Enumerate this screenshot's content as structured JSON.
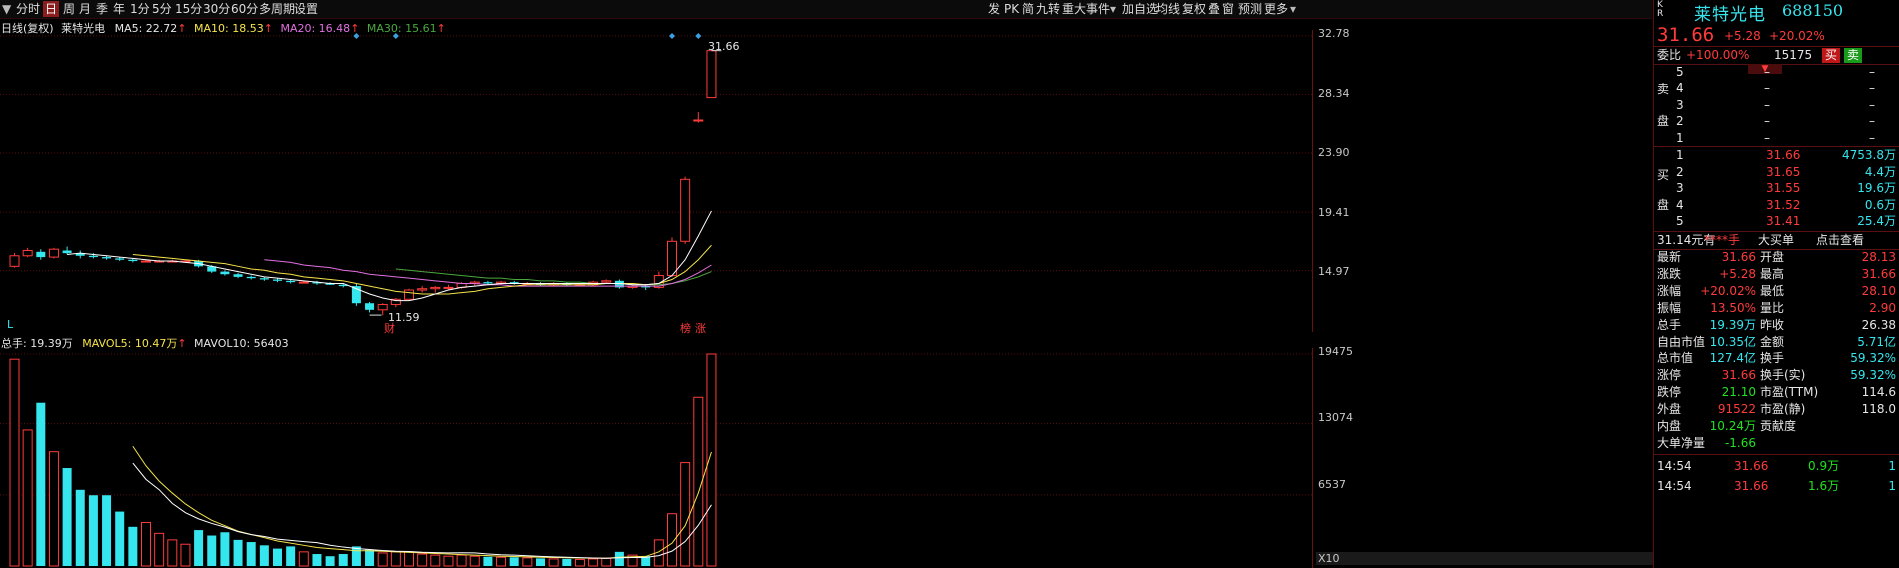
{
  "toolbar": {
    "left": [
      "分时",
      "日",
      "周",
      "月",
      "季",
      "年",
      "1分",
      "5分",
      "15分",
      "30分",
      "60分",
      "多周期",
      "设置"
    ],
    "selected": "日",
    "right": [
      "发",
      "PK",
      "简",
      "九转",
      "重大事件",
      "加自选",
      "均线",
      "复权",
      "叠",
      "窗",
      "预测",
      "更多"
    ]
  },
  "kline": {
    "legend": {
      "title": "日线(复权)",
      "name": "莱特光电",
      "ma5": "MA5: 22.72",
      "ma10": "MA10: 18.53",
      "ma20": "MA20: 16.48",
      "ma30": "MA30: 15.61"
    },
    "y_labels": [
      "32.78",
      "28.34",
      "23.90",
      "19.41",
      "14.97"
    ],
    "high_label": "31.66",
    "low_label": "11.59",
    "markers": {
      "cai": "财",
      "bang": "榜",
      "zhang": "涨",
      "L": "L"
    }
  },
  "volume": {
    "legend": {
      "total": "总手: 19.39万",
      "mavol5": "MAVOL5: 10.47万",
      "mavol10": "MAVOL10: 56403"
    },
    "y_labels": [
      "19475",
      "13074",
      "6537"
    ],
    "unit": "X10"
  },
  "chart_data": {
    "type": "candlestick",
    "ylim": [
      11.0,
      33.0
    ],
    "candles": [
      [
        15.3,
        16.3,
        15.2,
        16.1
      ],
      [
        16.1,
        16.7,
        16.0,
        16.5
      ],
      [
        16.4,
        16.6,
        15.8,
        16.0
      ],
      [
        16.0,
        16.7,
        15.9,
        16.6
      ],
      [
        16.5,
        16.8,
        16.2,
        16.3
      ],
      [
        16.3,
        16.5,
        15.9,
        16.1
      ],
      [
        16.1,
        16.3,
        15.9,
        16.0
      ],
      [
        16.0,
        16.1,
        15.8,
        15.9
      ],
      [
        15.9,
        16.0,
        15.7,
        15.8
      ],
      [
        15.8,
        15.9,
        15.6,
        15.7
      ],
      [
        15.7,
        15.8,
        15.6,
        15.7
      ],
      [
        15.7,
        15.8,
        15.6,
        15.7
      ],
      [
        15.7,
        15.8,
        15.6,
        15.7
      ],
      [
        15.7,
        15.8,
        15.6,
        15.7
      ],
      [
        15.7,
        15.8,
        15.2,
        15.3
      ],
      [
        15.3,
        15.4,
        14.8,
        14.9
      ],
      [
        14.9,
        15.0,
        14.6,
        14.7
      ],
      [
        14.7,
        14.8,
        14.4,
        14.5
      ],
      [
        14.5,
        14.6,
        14.3,
        14.4
      ],
      [
        14.4,
        14.5,
        14.2,
        14.3
      ],
      [
        14.3,
        14.4,
        14.1,
        14.2
      ],
      [
        14.2,
        14.3,
        14.0,
        14.1
      ],
      [
        14.1,
        14.2,
        14.0,
        14.1
      ],
      [
        14.1,
        14.2,
        13.9,
        14.0
      ],
      [
        14.0,
        14.1,
        13.9,
        13.9
      ],
      [
        13.9,
        14.0,
        13.7,
        13.8
      ],
      [
        13.8,
        14.0,
        12.3,
        12.5
      ],
      [
        12.5,
        12.6,
        11.8,
        12.0
      ],
      [
        12.0,
        12.5,
        11.6,
        12.4
      ],
      [
        12.4,
        12.9,
        12.2,
        12.8
      ],
      [
        12.8,
        13.6,
        12.8,
        13.5
      ],
      [
        13.5,
        13.8,
        13.3,
        13.6
      ],
      [
        13.6,
        13.8,
        13.3,
        13.7
      ],
      [
        13.7,
        13.9,
        13.5,
        13.7
      ],
      [
        13.7,
        14.1,
        13.6,
        14.0
      ],
      [
        14.0,
        14.2,
        13.8,
        14.1
      ],
      [
        14.1,
        14.2,
        13.9,
        14.0
      ],
      [
        14.0,
        14.2,
        13.9,
        14.1
      ],
      [
        14.1,
        14.2,
        13.9,
        14.0
      ],
      [
        14.0,
        14.1,
        13.9,
        14.0
      ],
      [
        14.0,
        14.1,
        13.8,
        13.9
      ],
      [
        13.9,
        14.1,
        13.8,
        14.0
      ],
      [
        14.0,
        14.1,
        13.8,
        13.9
      ],
      [
        13.9,
        14.0,
        13.8,
        13.9
      ],
      [
        13.9,
        14.2,
        13.8,
        14.1
      ],
      [
        14.1,
        14.3,
        14.0,
        14.2
      ],
      [
        14.2,
        14.3,
        13.6,
        13.7
      ],
      [
        13.7,
        13.9,
        13.6,
        13.8
      ],
      [
        13.8,
        13.9,
        13.5,
        13.7
      ],
      [
        13.7,
        14.9,
        13.6,
        14.6
      ],
      [
        14.6,
        17.5,
        14.5,
        17.2
      ],
      [
        17.2,
        22.1,
        17.0,
        21.9
      ],
      [
        26.4,
        27.0,
        26.2,
        26.4
      ],
      [
        28.1,
        31.66,
        28.1,
        31.66
      ]
    ],
    "ma5": [
      null,
      null,
      null,
      null,
      16.2,
      16.3,
      16.2,
      16.1,
      16.0,
      15.9,
      15.8,
      15.7,
      15.7,
      15.6,
      15.5,
      15.3,
      15.1,
      14.9,
      14.7,
      14.5,
      14.4,
      14.3,
      14.2,
      14.1,
      14.0,
      14.0,
      13.6,
      13.2,
      12.9,
      12.7,
      12.7,
      12.9,
      13.2,
      13.5,
      13.7,
      13.8,
      13.9,
      14.0,
      14.0,
      14.0,
      14.0,
      14.0,
      14.0,
      14.0,
      14.0,
      14.0,
      14.0,
      13.9,
      13.9,
      14.0,
      14.6,
      15.8,
      17.6,
      19.5
    ],
    "ma10": [
      null,
      null,
      null,
      null,
      null,
      null,
      null,
      null,
      null,
      16.2,
      16.1,
      16.0,
      15.9,
      15.8,
      15.7,
      15.6,
      15.5,
      15.3,
      15.1,
      15.0,
      14.8,
      14.7,
      14.5,
      14.4,
      14.3,
      14.2,
      14.0,
      13.8,
      13.6,
      13.4,
      13.3,
      13.2,
      13.2,
      13.2,
      13.3,
      13.4,
      13.6,
      13.7,
      13.8,
      13.9,
      13.9,
      13.9,
      13.9,
      13.9,
      13.9,
      14.0,
      14.0,
      14.0,
      13.9,
      14.0,
      14.3,
      14.9,
      15.8,
      16.9
    ],
    "ma20": [
      null,
      null,
      null,
      null,
      null,
      null,
      null,
      null,
      null,
      null,
      null,
      null,
      null,
      null,
      null,
      null,
      null,
      null,
      null,
      15.8,
      15.7,
      15.6,
      15.4,
      15.3,
      15.2,
      15.0,
      14.9,
      14.7,
      14.6,
      14.5,
      14.4,
      14.3,
      14.2,
      14.1,
      14.0,
      14.0,
      13.9,
      13.9,
      13.8,
      13.8,
      13.8,
      13.8,
      13.8,
      13.8,
      13.8,
      13.8,
      13.8,
      13.8,
      13.8,
      13.8,
      14.0,
      14.3,
      14.8,
      15.4
    ],
    "ma30": [
      null,
      null,
      null,
      null,
      null,
      null,
      null,
      null,
      null,
      null,
      null,
      null,
      null,
      null,
      null,
      null,
      null,
      null,
      null,
      null,
      null,
      null,
      null,
      null,
      null,
      null,
      null,
      null,
      null,
      15.1,
      15.0,
      14.9,
      14.8,
      14.7,
      14.6,
      14.5,
      14.4,
      14.4,
      14.3,
      14.3,
      14.2,
      14.2,
      14.1,
      14.1,
      14.0,
      14.0,
      14.0,
      13.9,
      13.9,
      13.9,
      14.0,
      14.2,
      14.5,
      14.9
    ],
    "volumes": [
      19000,
      12500,
      15000,
      10500,
      9000,
      7000,
      6500,
      6500,
      5000,
      3600,
      4000,
      3000,
      2400,
      2000,
      3300,
      2800,
      3100,
      2400,
      2200,
      1900,
      1600,
      1800,
      1300,
      1100,
      900,
      1100,
      1800,
      1500,
      1200,
      1300,
      1300,
      1100,
      1000,
      900,
      1000,
      900,
      850,
      800,
      800,
      750,
      700,
      650,
      650,
      600,
      650,
      700,
      1300,
      1000,
      900,
      2400,
      4800,
      9500,
      15500,
      19475
    ],
    "mavol5": [
      null,
      null,
      null,
      null,
      null,
      null,
      null,
      null,
      null,
      11000,
      9200,
      7800,
      6700,
      5700,
      4900,
      4200,
      3700,
      3200,
      2900,
      2600,
      2300,
      2100,
      1900,
      1700,
      1600,
      1500,
      1400,
      1400,
      1350,
      1300,
      1250,
      1200,
      1150,
      1100,
      1050,
      1000,
      950,
      900,
      870,
      840,
      800,
      780,
      760,
      740,
      720,
      710,
      800,
      850,
      880,
      1300,
      2100,
      3700,
      6700,
      10470
    ]
  },
  "panel": {
    "kr": "K\nR",
    "stock_name": "莱特光电",
    "stock_code": "688150",
    "price": "31.66",
    "change": "+5.28",
    "change_pct": "+20.02%",
    "weibi_label": "委比",
    "weibi_value": "+100.00%",
    "weibi_count": "15175",
    "buy_btn": "买",
    "sell_btn": "卖",
    "sell_side_label": [
      "卖",
      "盘"
    ],
    "sell_levels": [
      {
        "n": "5",
        "p": "–",
        "v": "–"
      },
      {
        "n": "4",
        "p": "–",
        "v": "–"
      },
      {
        "n": "3",
        "p": "–",
        "v": "–"
      },
      {
        "n": "2",
        "p": "–",
        "v": "–"
      },
      {
        "n": "1",
        "p": "–",
        "v": "–"
      }
    ],
    "buy_side_label": [
      "买",
      "盘"
    ],
    "buy_levels": [
      {
        "n": "1",
        "p": "31.66",
        "v": "4753.8万"
      },
      {
        "n": "2",
        "p": "31.65",
        "v": "4.4万"
      },
      {
        "n": "3",
        "p": "31.55",
        "v": "19.6万"
      },
      {
        "n": "4",
        "p": "31.52",
        "v": "0.6万"
      },
      {
        "n": "5",
        "p": "31.41",
        "v": "25.4万"
      }
    ],
    "bigorder": {
      "a": "31.14元有",
      "b": "****手",
      "c": "大买单",
      "d": "点击查看"
    },
    "stats": [
      {
        "l": "最新",
        "v": "31.66",
        "vc": "red",
        "l2": "开盘",
        "v2": "28.13",
        "v2c": "red"
      },
      {
        "l": "涨跌",
        "v": "+5.28",
        "vc": "red",
        "l2": "最高",
        "v2": "31.66",
        "v2c": "red"
      },
      {
        "l": "涨幅",
        "v": "+20.02%",
        "vc": "red",
        "l2": "最低",
        "v2": "28.10",
        "v2c": "red"
      },
      {
        "l": "振幅",
        "v": "13.50%",
        "vc": "red",
        "l2": "量比",
        "v2": "2.90",
        "v2c": "red"
      },
      {
        "l": "总手",
        "v": "19.39万",
        "vc": "cyan",
        "l2": "昨收",
        "v2": "26.38",
        "v2c": "white"
      },
      {
        "l": "自由市值",
        "v": "10.35亿",
        "vc": "cyan",
        "l2": "金额",
        "v2": "5.71亿",
        "v2c": "cyan"
      },
      {
        "l": "总市值",
        "v": "127.4亿",
        "vc": "cyan",
        "l2": "换手",
        "v2": "59.32%",
        "v2c": "cyan"
      },
      {
        "l": "涨停",
        "v": "31.66",
        "vc": "red",
        "l2": "换手(实)",
        "v2": "59.32%",
        "v2c": "cyan"
      },
      {
        "l": "跌停",
        "v": "21.10",
        "vc": "green",
        "l2": "市盈(TTM)",
        "v2": "114.6",
        "v2c": "white"
      },
      {
        "l": "外盘",
        "v": "91522",
        "vc": "red",
        "l2": "市盈(静)",
        "v2": "118.0",
        "v2c": "white"
      },
      {
        "l": "内盘",
        "v": "10.24万",
        "vc": "green",
        "l2": "贡献度",
        "v2": "",
        "v2c": "white"
      },
      {
        "l": "大单净量",
        "v": "-1.66",
        "vc": "green",
        "l2": "",
        "v2": "",
        "v2c": "white"
      }
    ],
    "ticks": [
      {
        "t": "14:54",
        "p": "31.66",
        "v": "0.9万",
        "n": "1"
      },
      {
        "t": "14:54",
        "p": "31.66",
        "v": "1.6万",
        "n": "1"
      }
    ]
  }
}
